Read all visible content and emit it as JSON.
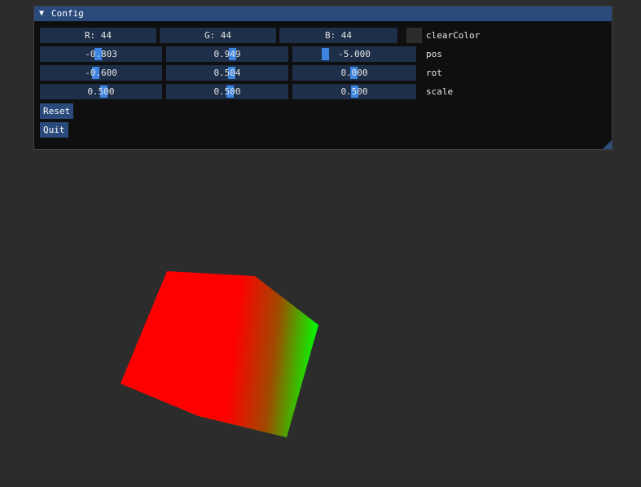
{
  "window": {
    "title": "Config",
    "collapse_icon": "triangle-down-icon",
    "colors": {
      "title_bar": "#294a7a",
      "window_bg": "#0f0f0f",
      "field_bg": "#1d2f49",
      "grab": "#3d85e0"
    }
  },
  "clear_color": {
    "label": "clearColor",
    "r": "R: 44",
    "g": "G: 44",
    "b": "B: 44",
    "swatch": "#2c2c2c"
  },
  "pos": {
    "label": "pos",
    "x": "-0.803",
    "y": "0.949",
    "z": "-5.000"
  },
  "rot": {
    "label": "rot",
    "x": "-0.600",
    "y": "0.504",
    "z": "0.000"
  },
  "scale": {
    "label": "scale",
    "x": "0.500",
    "y": "0.500",
    "z": "0.500"
  },
  "buttons": {
    "reset": "Reset",
    "quit": "Quit"
  },
  "scene": {
    "background": "#2c2c2c",
    "cube_colors": [
      "#ff0000",
      "#00ff00"
    ]
  }
}
